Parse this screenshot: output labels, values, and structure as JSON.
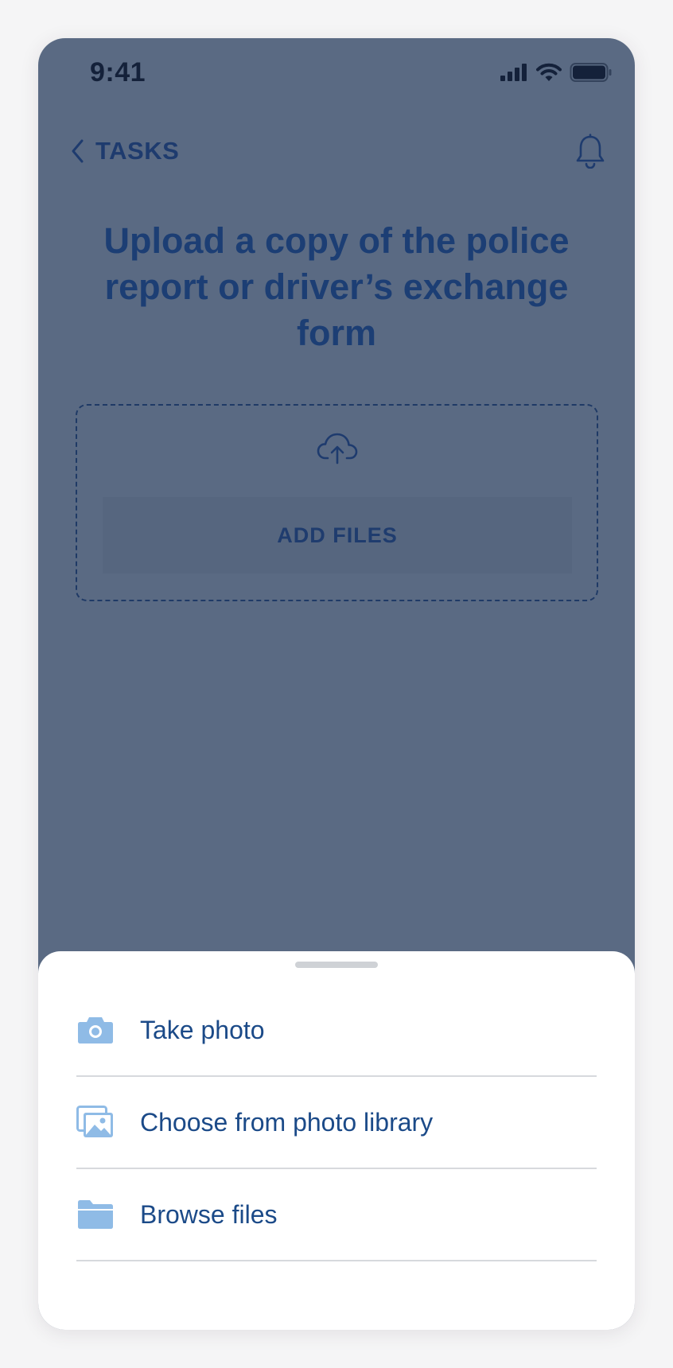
{
  "status_bar": {
    "time": "9:41"
  },
  "nav": {
    "back_label": "TASKS",
    "back_icon": "chevron-left-icon",
    "notification_icon": "bell-icon"
  },
  "page": {
    "title": "Upload a copy of the police report or driver’s exchange form"
  },
  "dropzone": {
    "icon": "cloud-upload-icon",
    "button_label": "ADD FILES"
  },
  "sheet": {
    "items": [
      {
        "icon": "camera-icon",
        "label": "Take photo"
      },
      {
        "icon": "photo-library-icon",
        "label": "Choose from photo library"
      },
      {
        "icon": "folder-icon",
        "label": "Browse files"
      }
    ]
  },
  "colors": {
    "overlay": "#5a6a83",
    "title": "#1c3e74",
    "sheet_background": "#ffffff",
    "item_label": "#1b4a88",
    "item_icon": "#8fbbe6"
  }
}
